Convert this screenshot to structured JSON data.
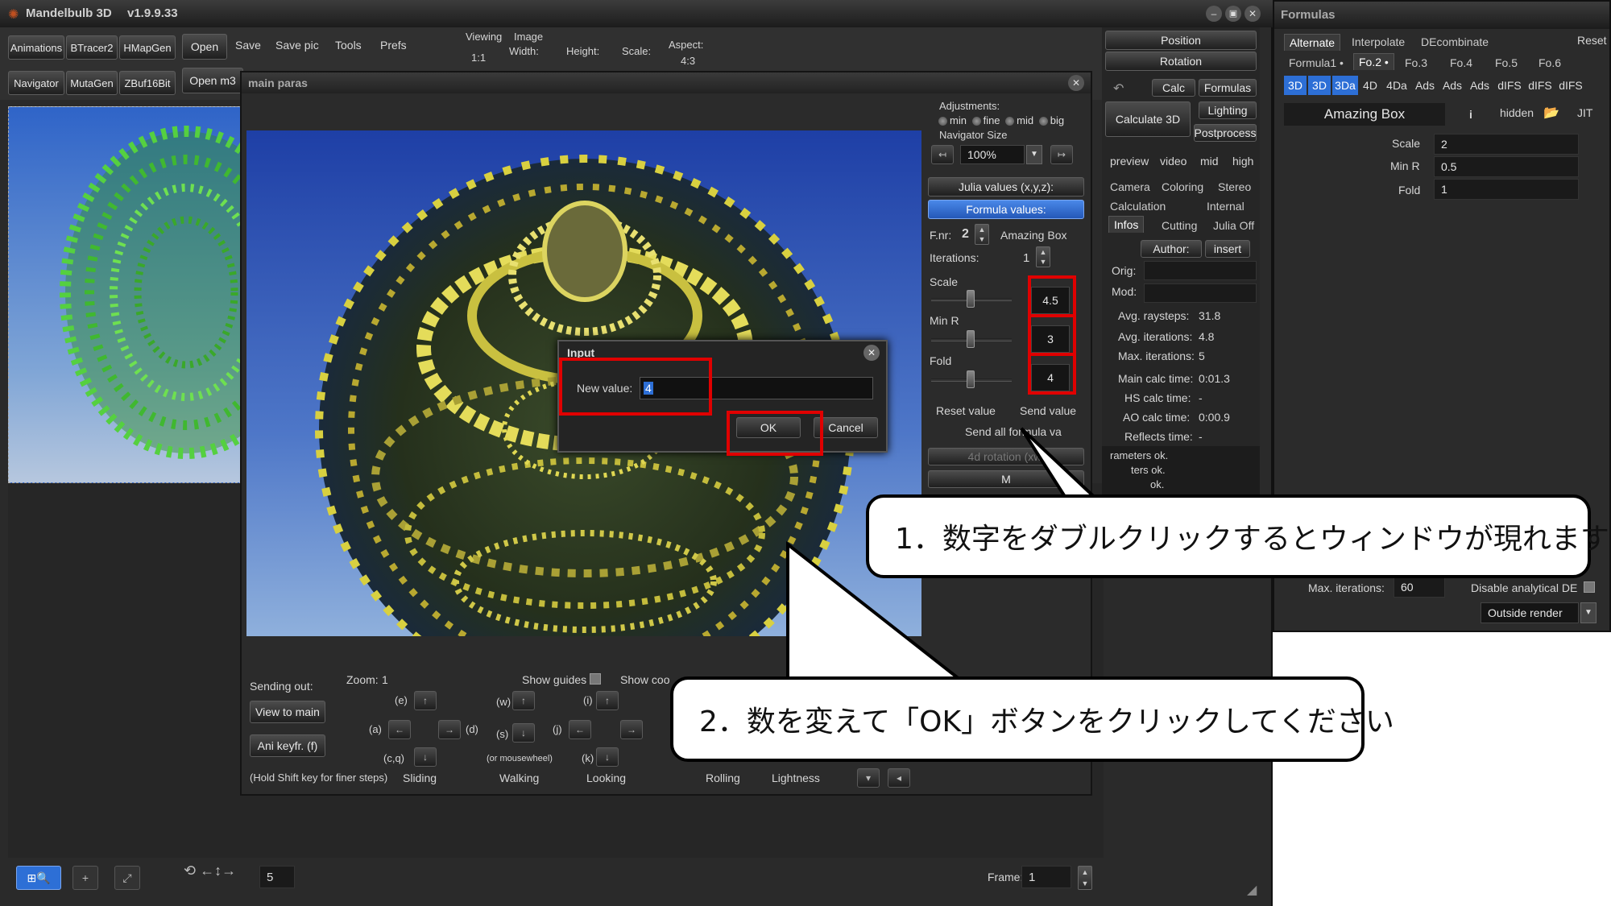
{
  "app": {
    "title": "Mandelbulb 3D",
    "version": "v1.9.9.33",
    "toolbar": {
      "animations": "Animations",
      "btracer2": "BTracer2",
      "hmapgen": "HMapGen",
      "navigator": "Navigator",
      "mutagen": "MutaGen",
      "zbuf16bit": "ZBuf16Bit",
      "open": "Open",
      "save": "Save",
      "savepic": "Save pic",
      "tools": "Tools",
      "prefs": "Prefs",
      "open_m3": "Open m3",
      "viewing": "Viewing",
      "viewing_value": "1:1",
      "image": "Image",
      "width": "Width:",
      "height": "Height:",
      "scale": "Scale:",
      "aspect": "Aspect:",
      "aspect_value": "4:3"
    },
    "right_panel": {
      "position": "Position",
      "rotation": "Rotation",
      "calc": "Calc",
      "formulas": "Formulas",
      "calculate3d": "Calculate 3D",
      "lighting": "Lighting",
      "postprocess": "Postprocess",
      "quality": [
        "preview",
        "video",
        "mid",
        "high"
      ],
      "tabs_row1": [
        "Camera",
        "Coloring",
        "Stereo"
      ],
      "tabs_row2": [
        "Calculation",
        "Internal"
      ],
      "tabs_row3": [
        "Infos",
        "Cutting",
        "Julia Off"
      ],
      "author": "Author:",
      "insert": "insert",
      "orig": "Orig:",
      "mod": "Mod:",
      "stats": [
        {
          "label": "Avg. raysteps:",
          "value": "31.8"
        },
        {
          "label": "Avg. iterations:",
          "value": "4.8"
        },
        {
          "label": "Max. iterations:",
          "value": "5"
        },
        {
          "label": "Main calc time:",
          "value": "0:01.3"
        },
        {
          "label": "HS calc time:",
          "value": "-"
        },
        {
          "label": "AO calc time:",
          "value": "0:00.9"
        },
        {
          "label": "Reflects time:",
          "value": "-"
        }
      ],
      "log1": "rameters ok.",
      "log2": "ters ok.",
      "log3": "ok."
    },
    "bottom": {
      "zoom_value": "5",
      "frame_label": "Frame:",
      "frame_value": "1"
    }
  },
  "main_paras": {
    "title": "main paras",
    "adjustments": "Adjustments:",
    "adj_options": [
      "min",
      "fine",
      "mid",
      "big"
    ],
    "navigator_size": "Navigator Size",
    "nav_size_value": "100%",
    "julia_values": "Julia values (x,y,z):",
    "formula_values": "Formula values:",
    "fnr_label": "F.nr:",
    "fnr_value": "2",
    "formula_name": "Amazing Box",
    "iterations_label": "Iterations:",
    "iterations_value": "1",
    "params": [
      {
        "label": "Scale",
        "value": "4.5"
      },
      {
        "label": "Min R",
        "value": "3"
      },
      {
        "label": "Fold",
        "value": "4"
      }
    ],
    "reset_value": "Reset value",
    "send_value": "Send value",
    "send_all": "Send all formula va",
    "rotation4d": "4d rotation (xw,",
    "m_btn": "M",
    "sending_out": "Sending out:",
    "view_to_main": "View to main",
    "ani_keyfr": "Ani keyfr. (f)",
    "hold_shift": "(Hold Shift key for finer steps)",
    "zoom": "Zoom:",
    "zoom_val": "1",
    "show_guides": "Show guides",
    "show_coo": "Show coo",
    "keys": [
      "(e)",
      "(a)",
      "(d)",
      "(c,q)",
      "(w)",
      "(s)",
      "(i)",
      "(j)",
      "(k)"
    ],
    "mousewheel": "(or mousewheel)",
    "modes": [
      "Sliding",
      "Walking",
      "Looking",
      "Rolling",
      "Lightness"
    ]
  },
  "dialog": {
    "title": "Input",
    "label": "New value:",
    "value": "4",
    "ok": "OK",
    "cancel": "Cancel"
  },
  "formulas_window": {
    "title": "Formulas",
    "tabs_top": [
      "Alternate",
      "Interpolate",
      "DEcombinate"
    ],
    "reset": "Reset",
    "formula_tabs": [
      "Formula1 •",
      "Fo.2 •",
      "Fo.3",
      "Fo.4",
      "Fo.5",
      "Fo.6"
    ],
    "type_tabs": [
      "3D",
      "3D",
      "3Da",
      "4D",
      "4Da",
      "Ads",
      "Ads",
      "Ads",
      "dIFS",
      "dIFS",
      "dIFS"
    ],
    "formula_name": "Amazing Box",
    "info": "i",
    "hidden": "hidden",
    "jit": "JIT",
    "params": [
      {
        "label": "Scale",
        "value": "2"
      },
      {
        "label": "Min R",
        "value": "0.5"
      },
      {
        "label": "Fold",
        "value": "1"
      }
    ],
    "max_iter_label": "Max. iterations:",
    "max_iter_value": "60",
    "disable_de": "Disable analytical DE",
    "outside_render": "Outside render"
  },
  "callouts": {
    "step1": "1．数字をダブルクリックするとウィンドウが現れます",
    "step2": "2．数を変えて「OK」ボタンをクリックしてください"
  },
  "colors": {
    "highlight": "#e00000",
    "selected_blue": "#2d6fd6",
    "window_bg": "#262626"
  }
}
